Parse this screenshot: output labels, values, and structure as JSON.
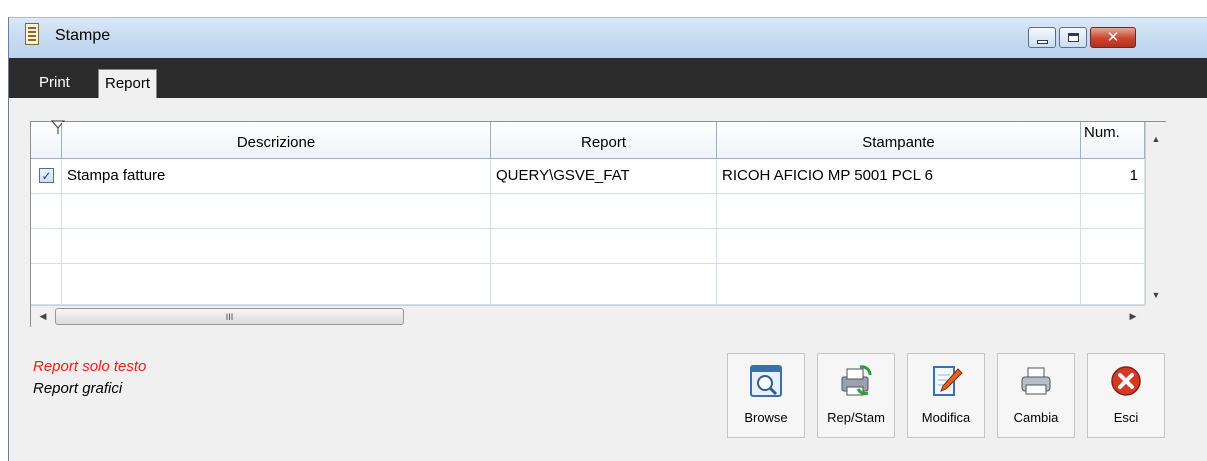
{
  "window": {
    "title": "Stampe"
  },
  "tabs": [
    {
      "label": "Print",
      "active": false
    },
    {
      "label": "Report",
      "active": true
    }
  ],
  "grid": {
    "columns": [
      "",
      "Descrizione",
      "Report",
      "Stampante",
      "Num."
    ],
    "rows": [
      {
        "checked": true,
        "descrizione": "Stampa fatture",
        "report": "QUERY\\GSVE_FAT",
        "stampante": "RICOH AFICIO MP 5001 PCL 6",
        "num": "1"
      },
      {
        "checked": false,
        "descrizione": "",
        "report": "",
        "stampante": "",
        "num": ""
      },
      {
        "checked": false,
        "descrizione": "",
        "report": "",
        "stampante": "",
        "num": ""
      },
      {
        "checked": false,
        "descrizione": "",
        "report": "",
        "stampante": "",
        "num": ""
      }
    ],
    "hscroll_thumb": "III"
  },
  "legend": {
    "text_only": "Report solo testo",
    "graphic": "Report grafici",
    "text_only_color": "#e8201b"
  },
  "buttons": [
    {
      "label": "Browse",
      "icon": "browse-icon"
    },
    {
      "label": "Rep/Stam",
      "icon": "printer-refresh-icon"
    },
    {
      "label": "Modifica",
      "icon": "edit-icon"
    },
    {
      "label": "Cambia",
      "icon": "printer-icon"
    },
    {
      "label": "Esci",
      "icon": "close-icon"
    }
  ],
  "colors": {
    "tabbar": "#2b2b2b",
    "window_bg": "#f0f0f0",
    "accent_close": "#d23b22"
  }
}
